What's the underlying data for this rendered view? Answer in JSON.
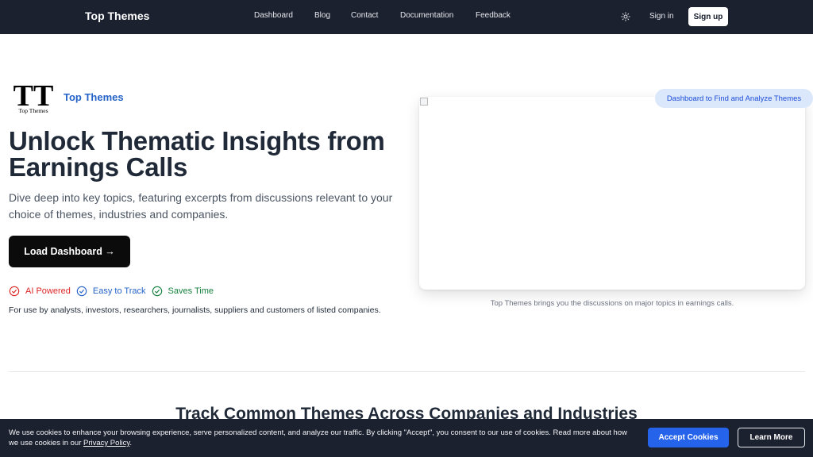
{
  "header": {
    "brand": "Top Themes",
    "nav": [
      "Dashboard",
      "Blog",
      "Contact",
      "Documentation",
      "Feedback"
    ],
    "theme_toggle_icon": "sun-icon",
    "signin": "Sign in",
    "signup": "Sign up"
  },
  "hero": {
    "logo_letters": "TT",
    "logo_caption": "Top Themes",
    "logo_word": "Top Themes",
    "title": "Unlock Thematic Insights from Earnings Calls",
    "subtitle": "Dive deep into key topics, featuring excerpts from discussions relevant to your choice of themes, industries and companies.",
    "cta": "Load Dashboard →",
    "badges": [
      "AI Powered",
      "Easy to Track",
      "Saves Time"
    ],
    "audience": "For use by analysts, investors, researchers, journalists, suppliers and customers of listed companies."
  },
  "preview": {
    "pill": "Dashboard to Find and Analyze Themes",
    "caption": "Top Themes brings you the discussions on major topics in earnings calls."
  },
  "section": {
    "title": "Track Common Themes Across Companies and Industries"
  },
  "cookie": {
    "text": "We use cookies to enhance your browsing experience, serve personalized content, and analyze our traffic. By clicking \"Accept\", you consent to our use of cookies. Read more about how we use cookies in our ",
    "link": "Privacy Policy",
    "end": ".",
    "accept": "Accept Cookies",
    "learn": "Learn More"
  },
  "colors": {
    "nav_bg": "#1c2130",
    "accent_blue": "#2563c9",
    "ai_red": "#dc2626",
    "save_green": "#15803d",
    "accept_blue": "#2563eb"
  }
}
